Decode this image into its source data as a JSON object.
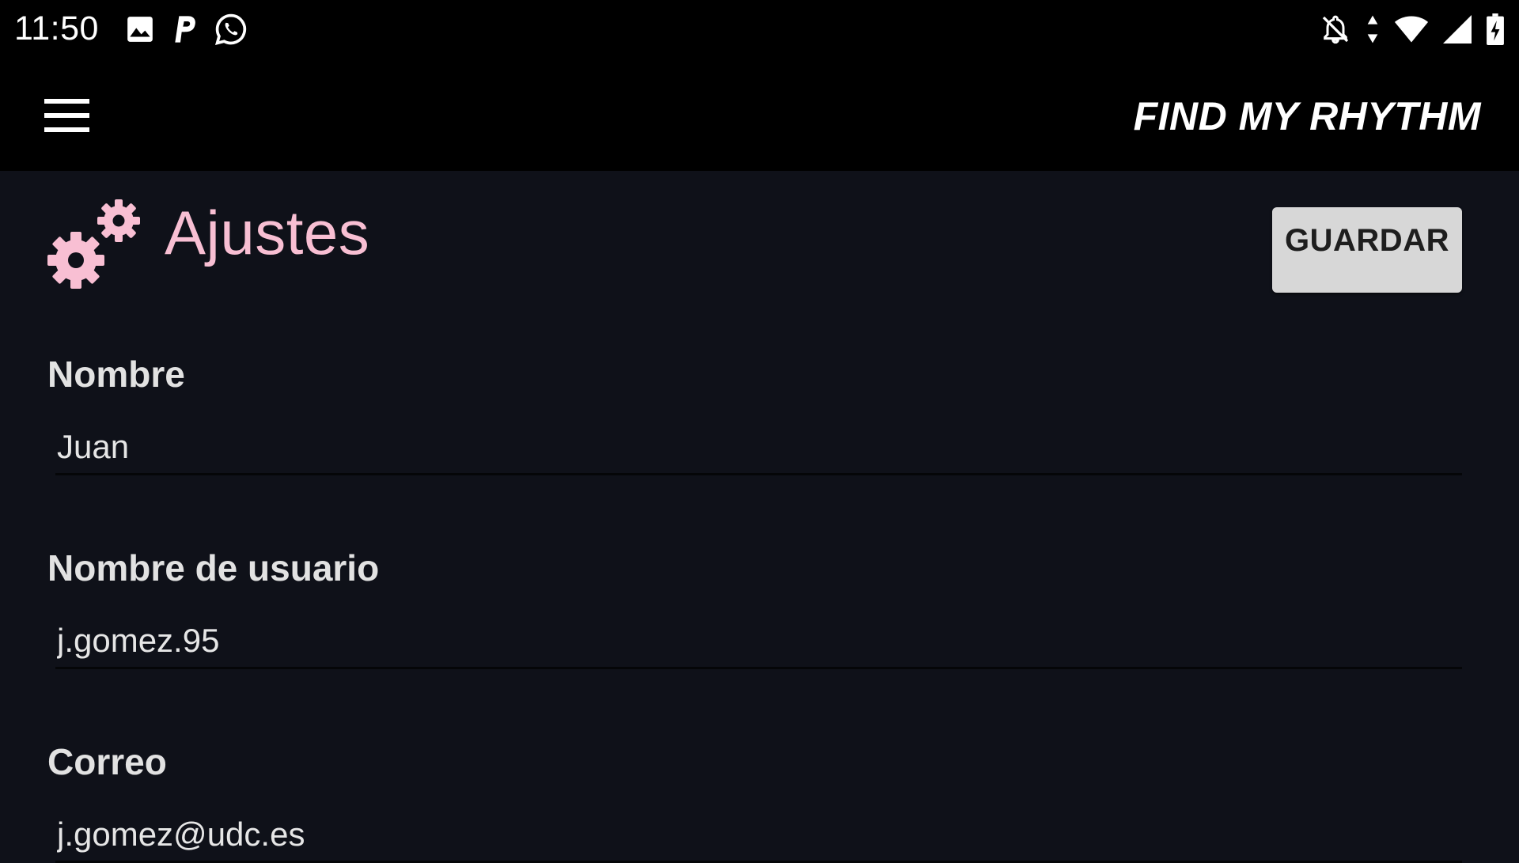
{
  "status_bar": {
    "time": "11:50",
    "left_icons": [
      "image-icon",
      "parking-p-icon",
      "whatsapp-icon"
    ],
    "right_icons": [
      "notifications-off-icon",
      "data-arrows-icon",
      "wifi-icon",
      "cell-signal-icon",
      "battery-charging-icon"
    ]
  },
  "app_bar": {
    "title": "FIND MY RHYTHM",
    "menu_icon": "hamburger-menu-icon"
  },
  "page": {
    "title": "Ajustes",
    "icon": "gears-icon",
    "save_label": "GUARDAR"
  },
  "fields": {
    "name": {
      "label": "Nombre",
      "value": "Juan"
    },
    "username": {
      "label": "Nombre de usuario",
      "value": "j.gomez.95"
    },
    "email": {
      "label": "Correo",
      "value": "j.gomez@udc.es"
    }
  },
  "colors": {
    "accent_pink": "#f8bfd3",
    "background": "#0f1119",
    "app_bar": "#000000",
    "button": "#d7d7d7"
  }
}
